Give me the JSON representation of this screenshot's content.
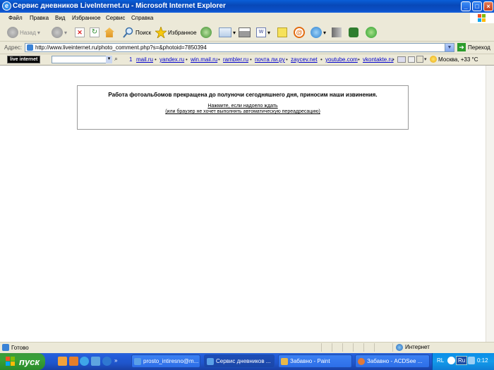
{
  "window": {
    "title": "Сервис дневников LiveInternet.ru - Microsoft Internet Explorer",
    "controls": [
      "_",
      "□",
      "×"
    ]
  },
  "menu": [
    "Файл",
    "Правка",
    "Вид",
    "Избранное",
    "Сервис",
    "Справка"
  ],
  "toolbar": {
    "back": "Назад",
    "search": "Поиск",
    "favorites": "Избранное"
  },
  "address": {
    "label": "Адрес:",
    "url": "http://www.liveinternet.ru/photo_comment.php?s=&photoid=7850394",
    "go": "Переход"
  },
  "links": {
    "brand": "live internet",
    "number": "1",
    "items": [
      "mail.ru",
      "yandex.ru",
      "win.mail.ru",
      "rambler.ru",
      "почта ли.ру",
      "zaycev.net",
      "youtube.com",
      "vkontakte.ru"
    ],
    "weather": "Москва, +33 °C"
  },
  "content": {
    "message": "Работа фотоальбомов прекращена до полуночи сегодняшнего дня, приносим наши извинения.",
    "link1": "Нажмите, если надоело ждать",
    "link2": "(или браузер не хочет выполнять автоматическую переадресацию)"
  },
  "status": {
    "text": "Готово",
    "zone": "Интернет"
  },
  "taskbar": {
    "start": "пуск",
    "tasks": [
      "prosto_intiresno@m...",
      "Сервис дневников ...",
      "Забавно - Paint",
      "Забавно - ACDSee ..."
    ],
    "lang": "RL",
    "lang2": "Ru",
    "clock": "0:12"
  },
  "colors": {
    "titlebar": "#0B4FC6",
    "taskbar": "#245EDC",
    "start": "#37A137",
    "link": "#0000CC"
  }
}
